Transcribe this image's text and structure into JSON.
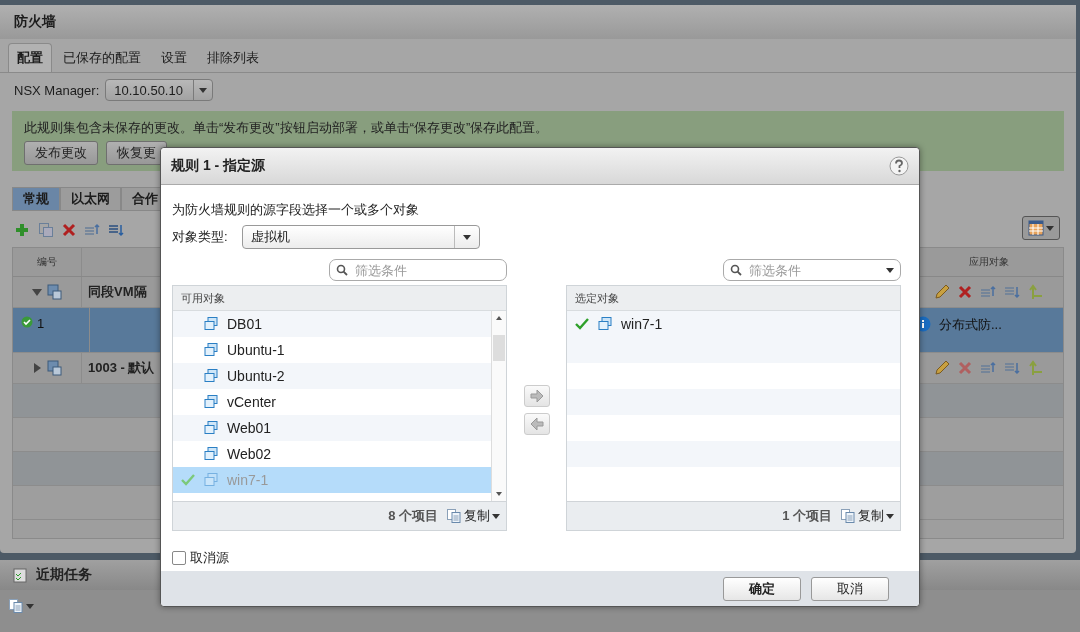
{
  "window": {
    "title": "防火墙"
  },
  "tabs": [
    {
      "label": "配置",
      "selected": true
    },
    {
      "label": "已保存的配置",
      "selected": false
    },
    {
      "label": "设置",
      "selected": false
    },
    {
      "label": "排除列表",
      "selected": false
    }
  ],
  "manager": {
    "label": "NSX Manager:",
    "value": "10.10.50.10"
  },
  "banner": {
    "message": "此规则集包含未保存的更改。单击“发布更改”按钮启动部署，或单击“保存更改”保存此配置。",
    "buttons": [
      "发布更改",
      "恢复更"
    ]
  },
  "subtabs": [
    {
      "label": "常规",
      "selected": true
    },
    {
      "label": "以太网",
      "selected": false
    },
    {
      "label": "合作",
      "selected": false
    }
  ],
  "rules": {
    "columns": [
      {
        "label": "编号"
      },
      {
        "label": "应用对象"
      }
    ],
    "rows": [
      {
        "kind": "section",
        "expanded": true,
        "name": "同段VM隔"
      },
      {
        "kind": "rule",
        "selected": true,
        "number": "1",
        "applied_to": "分布式防..."
      },
      {
        "kind": "section",
        "expanded": false,
        "name": "1003 - 默认"
      }
    ]
  },
  "recent_tasks": {
    "title": "近期任务"
  },
  "dialog": {
    "title": "规则 1 - 指定源",
    "description": "为防火墙规则的源字段选择一个或多个对象",
    "object_type": {
      "label": "对象类型:",
      "value": "虚拟机"
    },
    "available": {
      "filter_placeholder": "筛选条件",
      "filter_menu": false,
      "header": "可用对象",
      "items": [
        {
          "name": "DB01",
          "added": false,
          "selected": false
        },
        {
          "name": "Ubuntu-1",
          "added": false,
          "selected": false
        },
        {
          "name": "Ubuntu-2",
          "added": false,
          "selected": false
        },
        {
          "name": "vCenter",
          "added": false,
          "selected": false
        },
        {
          "name": "Web01",
          "added": false,
          "selected": false
        },
        {
          "name": "Web02",
          "added": false,
          "selected": false
        },
        {
          "name": "win7-1",
          "added": true,
          "selected": true
        }
      ],
      "count": "8 个项目",
      "copy": "复制"
    },
    "chosen": {
      "filter_placeholder": "筛选条件",
      "filter_menu": true,
      "header": "选定对象",
      "items": [
        {
          "name": "win7-1",
          "added": true,
          "selected": false
        }
      ],
      "count": "1 个项目",
      "copy": "复制"
    },
    "cancel_source": {
      "label": "取消源",
      "checked": false
    },
    "buttons": [
      {
        "label": "确定",
        "kind": "primary"
      },
      {
        "label": "取消",
        "kind": "secondary"
      }
    ]
  }
}
